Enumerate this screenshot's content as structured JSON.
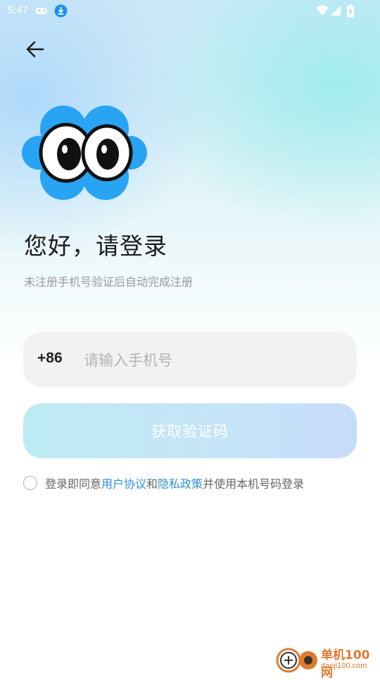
{
  "status_bar": {
    "time": "5:47",
    "icons": [
      "gamepad-icon",
      "download-icon",
      "wifi-icon",
      "signal-icon",
      "battery-icon"
    ]
  },
  "header": {
    "back_icon": "arrow-left-icon"
  },
  "logo": {
    "icon": "eyes-cloud-logo",
    "color": "#29A3F3"
  },
  "main": {
    "greeting": "您好，请登录",
    "subtitle": "未注册手机号验证后自动完成注册",
    "country_code": "+86",
    "phone_placeholder": "请输入手机号",
    "phone_value": "",
    "get_code_label": "获取验证码"
  },
  "agreement": {
    "checked": false,
    "prefix": "登录即同意",
    "user_agreement": "用户协议",
    "and": "和",
    "privacy_policy": "隐私政策",
    "suffix": "并使用本机号码登录"
  },
  "watermark": {
    "brand": "单机100网",
    "domain": "danji100.com"
  },
  "colors": {
    "accent": "#2D8FD8",
    "button": "#C6E4F8",
    "input_bg": "#F2F2F2"
  }
}
